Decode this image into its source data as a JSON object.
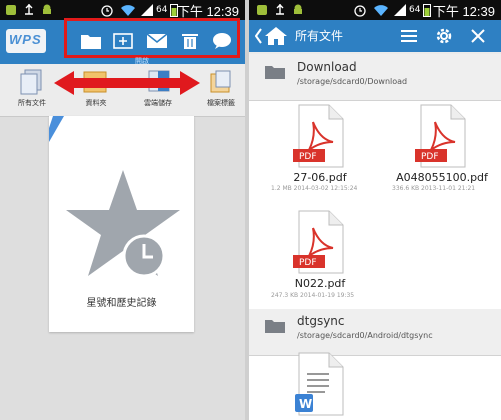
{
  "status_left": {
    "time": "下午 12:39",
    "battery": "64"
  },
  "status_right": {
    "time": "下午 12:39",
    "battery": "64"
  },
  "left": {
    "logo": "WPS",
    "toolbar": {
      "open_label": "開啟",
      "icons": [
        "folder-icon",
        "new-document-icon",
        "mail-icon",
        "trash-icon",
        "chat-icon"
      ]
    },
    "categories": [
      {
        "label": "所有文件",
        "icon": "all-documents-icon"
      },
      {
        "label": "資料夾",
        "icon": "folder-icon"
      },
      {
        "label": "雲端儲存",
        "icon": "cloud-storage-icon"
      },
      {
        "label": "檔案標籤",
        "icon": "file-tags-icon"
      }
    ],
    "card_label": "星號和歷史記錄"
  },
  "right": {
    "title": "所有文件",
    "folders": [
      {
        "name": "Download",
        "path": "/storage/sdcard0/Download",
        "files": [
          {
            "name": "27-06.pdf",
            "meta": "1.2 MB 2014-03-02 12:15:24",
            "badge": "PDF"
          },
          {
            "name": "A048055100.pdf",
            "meta": "336.6 KB 2013-11-01 21:21",
            "badge": "PDF"
          },
          {
            "name": "N022.pdf",
            "meta": "247.3 KB 2014-01-19 19:35",
            "badge": "PDF"
          }
        ]
      },
      {
        "name": "dtgsync",
        "path": "/storage/sdcard0/Android/dtgsync",
        "files": []
      }
    ]
  },
  "colors": {
    "toolbar_blue": "#2e80c3",
    "highlight_red": "#e21a1a",
    "pdf_red": "#d9332b",
    "star_gray": "#a0a6ad"
  }
}
